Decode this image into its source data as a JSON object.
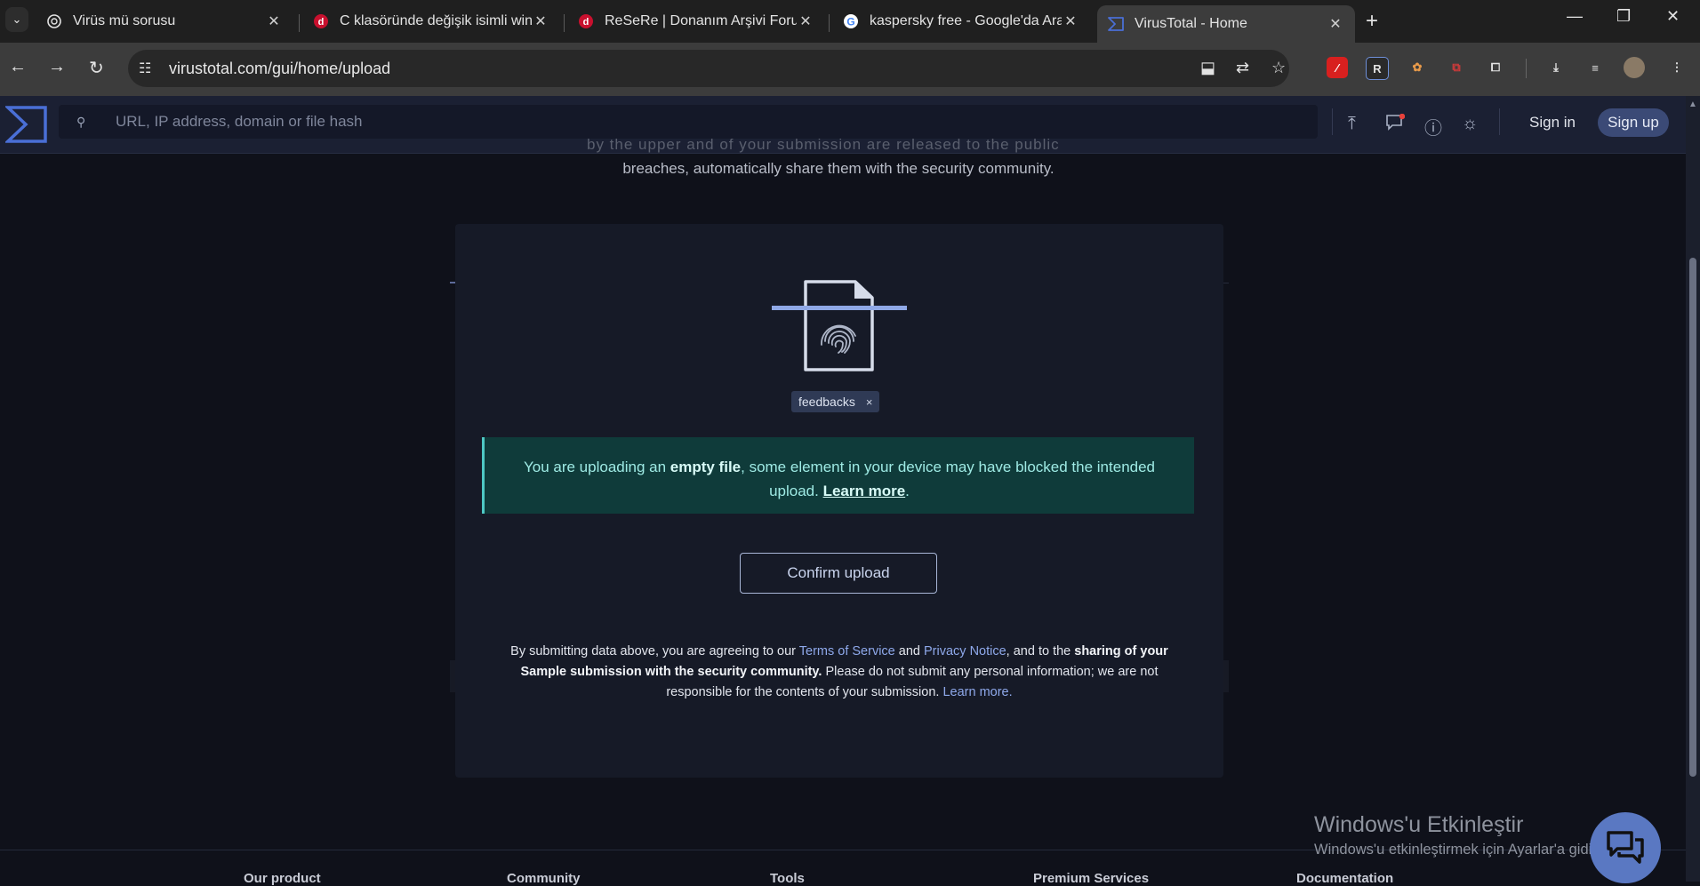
{
  "browser": {
    "tab_search_glyph": "⌄",
    "tabs": [
      {
        "title": "Virüs mü sorusu",
        "icon": "chatgpt-icon"
      },
      {
        "title": "C klasöründe değişik isimli windows",
        "icon": "technopat-icon"
      },
      {
        "title": "ReSeRe | Donanım Arşivi Forum",
        "icon": "technopat-icon"
      },
      {
        "title": "kaspersky free - Google'da Ara",
        "icon": "google-icon"
      },
      {
        "title": "VirusTotal - Home",
        "icon": "virustotal-icon"
      }
    ],
    "url": "virustotal.com/gui/home/upload"
  },
  "vt_header": {
    "search_placeholder": "URL, IP address, domain or file hash",
    "sign_in": "Sign in",
    "sign_up": "Sign up"
  },
  "intro": {
    "clipped_line": "by the upper  and  of  your  submission  are  released  to  the  public",
    "text": "breaches, automatically share them with the security community."
  },
  "upload_card": {
    "file_chip": "feedbacks",
    "chip_close": "×",
    "alert_part1": "You are uploading an ",
    "alert_bold": "empty file",
    "alert_part2": ", some element in your device may have blocked the intended upload. ",
    "alert_link": "Learn more",
    "alert_end": ".",
    "confirm_button": "Confirm upload",
    "terms_1": "By submitting data above, you are agreeing to our ",
    "terms_link_tos": "Terms of Service",
    "terms_and": " and ",
    "terms_link_privacy": "Privacy Notice",
    "terms_2": ", and to the ",
    "terms_bold": "sharing of your Sample submission with the security community.",
    "terms_3": " Please do not submit any personal information; we are not responsible for the contents of your submission. ",
    "terms_link_learn": "Learn more."
  },
  "footer_columns": [
    "Our product",
    "Community",
    "Tools",
    "Premium Services",
    "Documentation"
  ],
  "windows_activation": {
    "title": "Windows'u Etkinleştir",
    "subtitle": "Windows'u etkinleştirmek için Ayarlar'a gidin."
  },
  "colors": {
    "accent": "#5a78c2",
    "alert_bg": "#0f3b3a",
    "alert_border": "#4ec8c4",
    "page_bg": "#0f111a"
  }
}
